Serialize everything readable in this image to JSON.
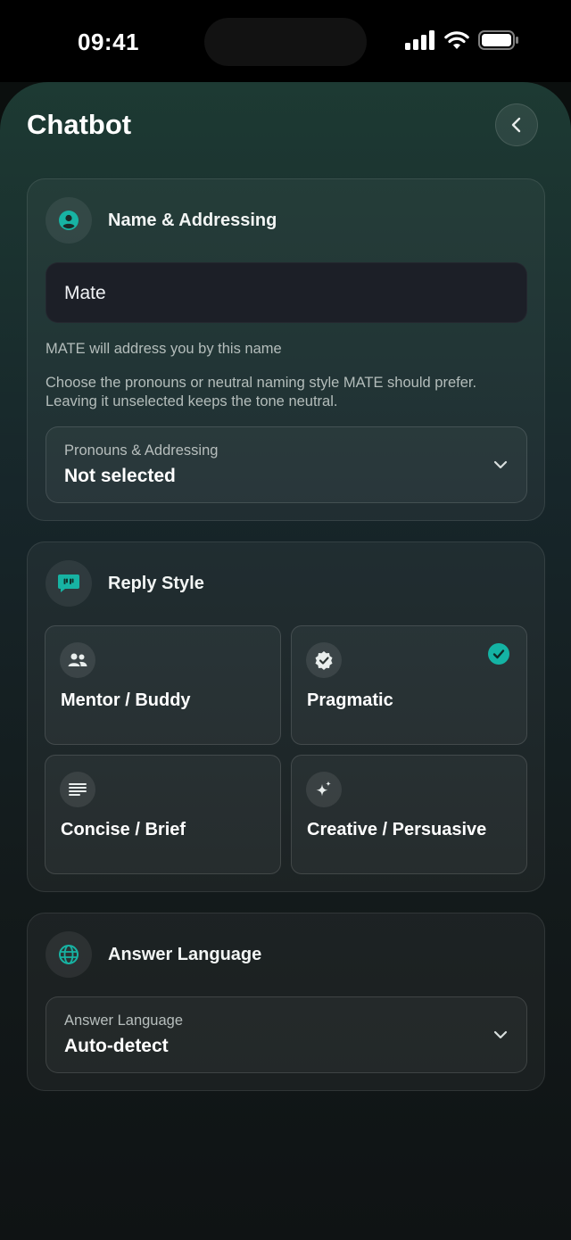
{
  "status": {
    "time": "09:41"
  },
  "page": {
    "title": "Chatbot"
  },
  "name_card": {
    "title": "Name & Addressing",
    "name_value": "Mate",
    "name_hint": "MATE will address you by this name",
    "pronoun_hint": "Choose the pronouns or neutral naming style MATE should prefer. Leaving it unselected keeps the tone neutral.",
    "pronoun_select": {
      "label": "Pronouns & Addressing",
      "value": "Not selected"
    }
  },
  "reply_card": {
    "title": "Reply Style",
    "options": [
      {
        "label": "Mentor / Buddy",
        "icon": "people-icon",
        "selected": false
      },
      {
        "label": "Pragmatic",
        "icon": "verified-badge-icon",
        "selected": true
      },
      {
        "label": "Concise / Brief",
        "icon": "lines-icon",
        "selected": false
      },
      {
        "label": "Creative / Persuasive",
        "icon": "sparkle-icon",
        "selected": false
      }
    ]
  },
  "language_card": {
    "title": "Answer Language",
    "select": {
      "label": "Answer Language",
      "value": "Auto-detect"
    }
  },
  "colors": {
    "accent": "#14b3a4",
    "background": "#131a1b"
  }
}
